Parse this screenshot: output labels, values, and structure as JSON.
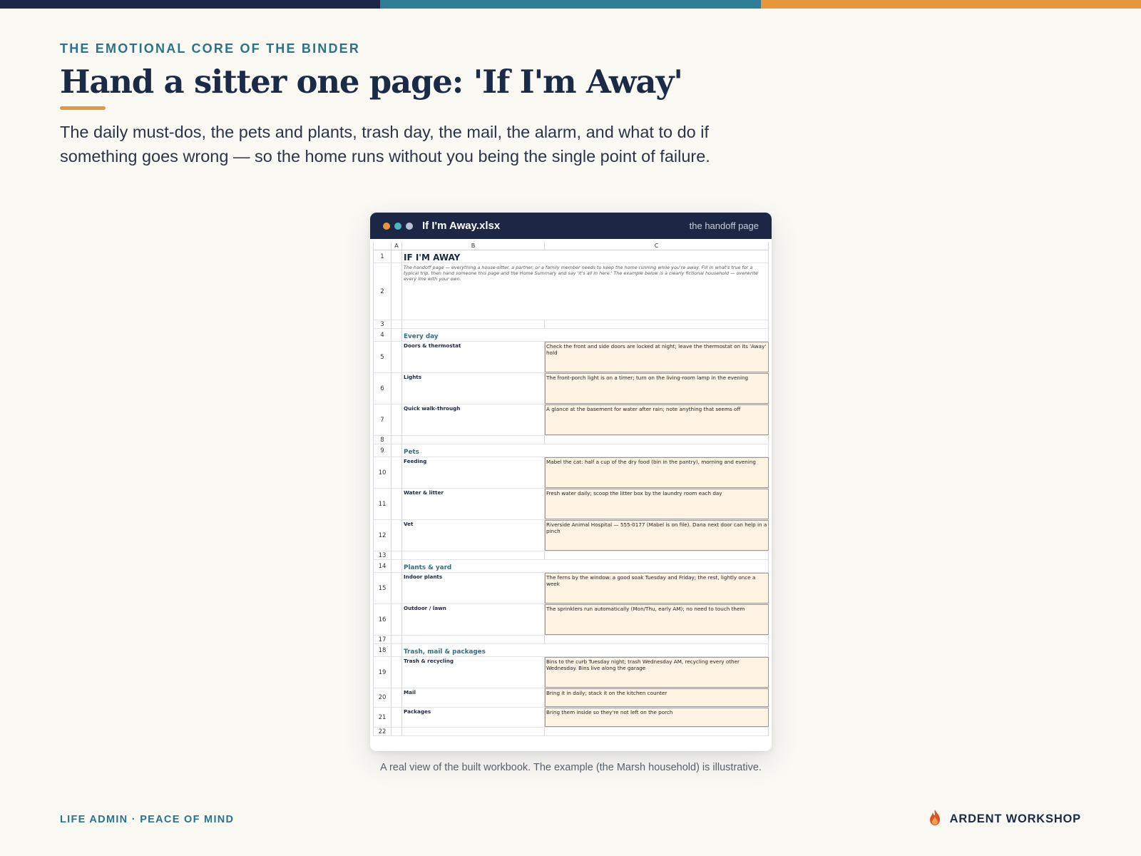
{
  "colors": {
    "navy": "#1b2745",
    "teal": "#2a7388",
    "orange": "#e8963d",
    "background": "#fbf9f4",
    "note_fill": "#fff3e3"
  },
  "top_bar": [
    "#1b2745",
    "#2e7f95",
    "#e8963d"
  ],
  "eyebrow": "THE EMOTIONAL CORE OF THE BINDER",
  "title": "Hand a sitter one page: 'If I'm Away'",
  "lede": "The daily must-dos, the pets and plants, trash day, the mail, the alarm, and what to do if something goes wrong — so the home runs without you being the single point of failure.",
  "window": {
    "dots": [
      "#e8963d",
      "#4fb3c4",
      "#b9c3d6"
    ],
    "title": "If I'm Away.xlsx",
    "subtitle": "the handoff page"
  },
  "sheet": {
    "col_headers": [
      "A",
      "B",
      "C"
    ],
    "sheet_title": "IF I'M AWAY",
    "intro": "The handoff page — everything a house-sitter, a partner, or a family member needs to keep the home running while you're away. Fill in what's true for a typical trip, then hand someone this page and the Home Summary and say 'it's all in here.' The example below is a clearly fictional household — overwrite every line with your own.",
    "rows": [
      {
        "n": "1",
        "kind": "title"
      },
      {
        "n": "2",
        "kind": "intro"
      },
      {
        "n": "3",
        "kind": "blank"
      },
      {
        "n": "4",
        "kind": "section",
        "label": "Every day"
      },
      {
        "n": "5",
        "kind": "item",
        "label": "Doors & thermostat",
        "value": "Check the front and side doors are locked at night; leave the thermostat on its 'Away' hold"
      },
      {
        "n": "6",
        "kind": "item",
        "label": "Lights",
        "value": "The front-porch light is on a timer; turn on the living-room lamp in the evening"
      },
      {
        "n": "7",
        "kind": "item",
        "label": "Quick walk-through",
        "value": "A glance at the basement for water after rain; note anything that seems off"
      },
      {
        "n": "8",
        "kind": "blank"
      },
      {
        "n": "9",
        "kind": "section",
        "label": "Pets"
      },
      {
        "n": "10",
        "kind": "item",
        "label": "Feeding",
        "value": "Mabel the cat: half a cup of the dry food (bin in the pantry), morning and evening"
      },
      {
        "n": "11",
        "kind": "item",
        "label": "Water & litter",
        "value": "Fresh water daily; scoop the litter box by the laundry room each day"
      },
      {
        "n": "12",
        "kind": "item",
        "label": "Vet",
        "value": "Riverside Animal Hospital — 555-0177 (Mabel is on file). Dana next door can help in a pinch"
      },
      {
        "n": "13",
        "kind": "blank"
      },
      {
        "n": "14",
        "kind": "section",
        "label": "Plants & yard"
      },
      {
        "n": "15",
        "kind": "item",
        "label": "Indoor plants",
        "value": "The ferns by the window: a good soak Tuesday and Friday; the rest, lightly once a week"
      },
      {
        "n": "16",
        "kind": "item",
        "label": "Outdoor / lawn",
        "value": "The sprinklers run automatically (Mon/Thu, early AM); no need to touch them"
      },
      {
        "n": "17",
        "kind": "blank"
      },
      {
        "n": "18",
        "kind": "section",
        "label": "Trash, mail & packages"
      },
      {
        "n": "19",
        "kind": "item",
        "label": "Trash & recycling",
        "value": "Bins to the curb Tuesday night; trash Wednesday AM, recycling every other Wednesday. Bins live along the garage"
      },
      {
        "n": "20",
        "kind": "item",
        "label": "Mail",
        "value": "Bring it in daily; stack it on the kitchen counter"
      },
      {
        "n": "21",
        "kind": "item",
        "label": "Packages",
        "value": "Bring them inside so they're not left on the porch"
      },
      {
        "n": "22",
        "kind": "blank"
      }
    ]
  },
  "caption": "A real view of the built workbook. The example (the Marsh household) is illustrative.",
  "footer_left": "LIFE ADMIN · PEACE OF MIND",
  "brand": {
    "name": "ARDENT WORKSHOP",
    "icon": "flame-icon"
  }
}
